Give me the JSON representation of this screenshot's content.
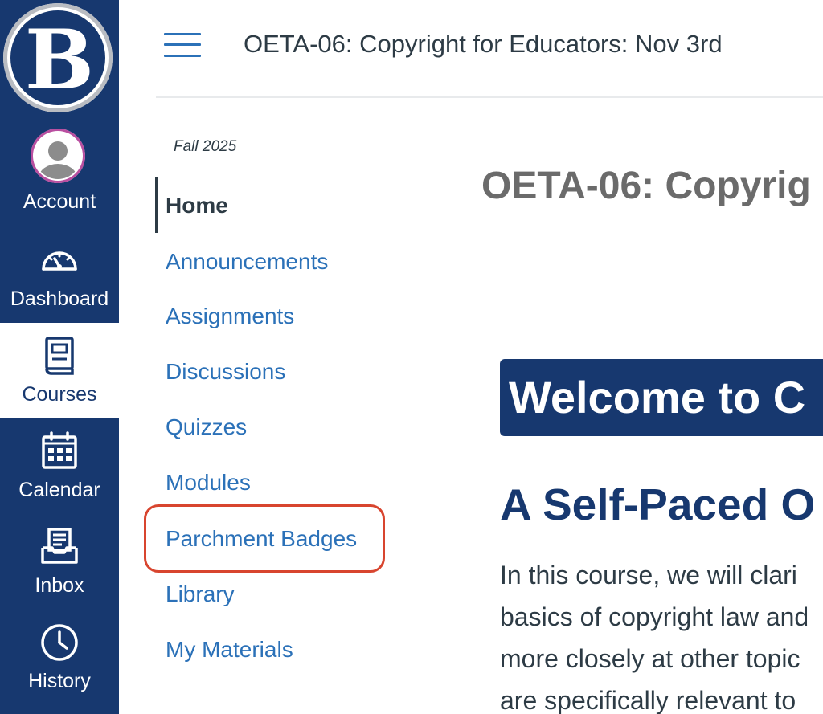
{
  "global_nav": {
    "logo_letter": "B",
    "items": [
      {
        "label": "Account",
        "icon": "avatar-icon"
      },
      {
        "label": "Dashboard",
        "icon": "speedometer-icon"
      },
      {
        "label": "Courses",
        "icon": "book-icon",
        "active": true
      },
      {
        "label": "Calendar",
        "icon": "calendar-icon"
      },
      {
        "label": "Inbox",
        "icon": "inbox-icon"
      },
      {
        "label": "History",
        "icon": "clock-icon"
      }
    ],
    "colors": {
      "background": "#17386f",
      "active_background": "#ffffff",
      "avatar_ring": "#b94fa0"
    }
  },
  "header": {
    "title": "OETA-06: Copyright for Educators: Nov 3rd",
    "menu_icon": "hamburger-icon"
  },
  "course_nav": {
    "term": "Fall 2025",
    "items": [
      {
        "label": "Home",
        "active": true
      },
      {
        "label": "Announcements"
      },
      {
        "label": "Assignments"
      },
      {
        "label": "Discussions"
      },
      {
        "label": "Quizzes"
      },
      {
        "label": "Modules"
      },
      {
        "label": "Parchment Badges",
        "highlighted": true
      },
      {
        "label": "Library"
      },
      {
        "label": "My Materials"
      }
    ],
    "colors": {
      "link": "#2b71b8",
      "highlight_outline": "#d8452f"
    }
  },
  "main": {
    "page_title": "OETA-06: Copyrig",
    "welcome_banner": "Welcome to C",
    "subheading": "A Self-Paced O",
    "paragraph_lines": [
      "In this course, we will clari",
      "basics of copyright law and",
      "more closely at other topic",
      "are specifically relevant to"
    ],
    "colors": {
      "banner": "#17386f",
      "heading": "#17386f",
      "title": "#6b6b6b"
    }
  }
}
